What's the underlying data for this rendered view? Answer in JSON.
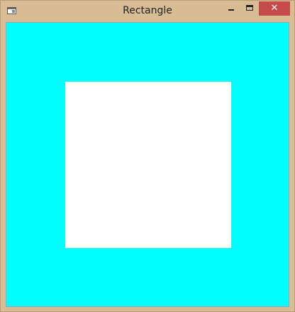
{
  "window": {
    "title": "Rectangle",
    "close_glyph": "✕"
  },
  "colors": {
    "frame": "#d8bc94",
    "client_background": "#00ffff",
    "rectangle_fill": "#ffffff",
    "close_button": "#c74a4a"
  },
  "icons": {
    "app": "app-icon",
    "minimize": "minimize-icon",
    "maximize": "maximize-icon",
    "close": "close-icon"
  }
}
